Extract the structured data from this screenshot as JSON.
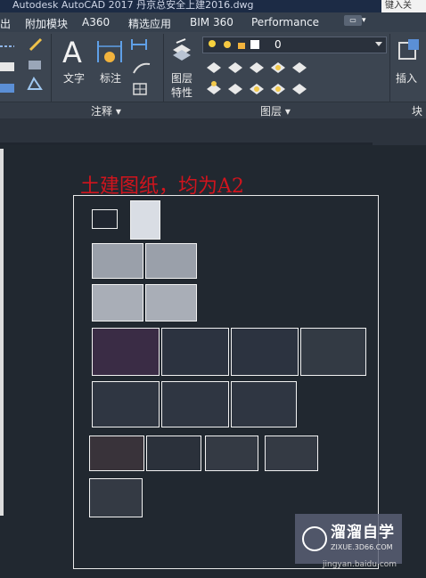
{
  "window": {
    "title": "Autodesk AutoCAD 2017    丹京总安全上建2016.dwg",
    "search_label": "键入关"
  },
  "menubar": {
    "items": [
      "出",
      "附加模块",
      "A360",
      "精选应用",
      "BIM 360",
      "Performance"
    ]
  },
  "ribbon": {
    "annotation": {
      "text_label": "文字",
      "dimension_label": "标注",
      "panel_title": "注释 ▾"
    },
    "layers": {
      "properties_label_1": "图层",
      "properties_label_2": "特性",
      "current_layer": "0",
      "panel_title": "图层 ▾"
    },
    "block": {
      "insert_label": "插入",
      "panel_title": "块"
    }
  },
  "drawing": {
    "annotation_text": "土建图纸，均为A2",
    "watermark_title": "溜溜自学",
    "watermark_url": "ZIXUE.3D66.COM",
    "source_text": "jingyan.baidu.com"
  },
  "colors": {
    "annotation": "#d1141d",
    "background": "#212830",
    "ribbon": "#3c4551"
  }
}
